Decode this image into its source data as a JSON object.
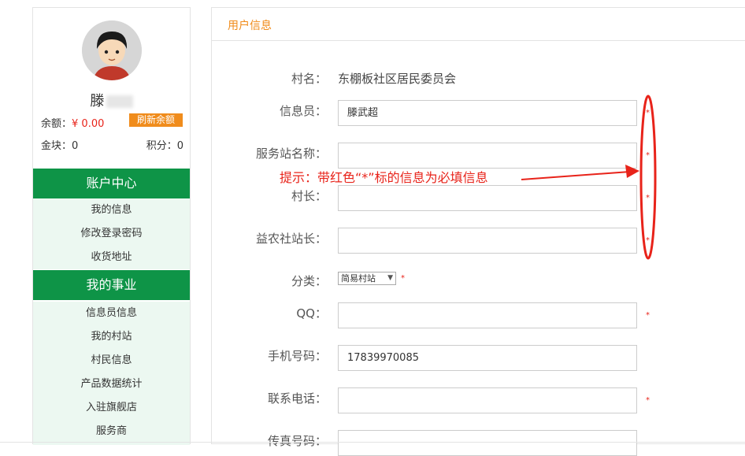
{
  "sidebar": {
    "username_visible": "滕",
    "balance_label": "余额：",
    "balance_value": "¥ 0.00",
    "refresh_button": "刷新余额",
    "gold_label": "金块：0",
    "points_label": "积分：0",
    "sections": [
      {
        "title": "账户中心",
        "items": [
          "我的信息",
          "修改登录密码",
          "收货地址"
        ]
      },
      {
        "title": "我的事业",
        "items": [
          "信息员信息",
          "我的村站",
          "村民信息",
          "产品数据统计",
          "入驻旗舰店",
          "服务商"
        ]
      }
    ]
  },
  "main": {
    "title": "用户信息",
    "village_label": "村名：",
    "village_value": "东棚板社区居民委员会",
    "fields": {
      "informant": {
        "label": "信息员：",
        "value": "滕武超"
      },
      "station_name": {
        "label": "服务站名称：",
        "value": ""
      },
      "village_head": {
        "label": "村长：",
        "value": ""
      },
      "yinong_head": {
        "label": "益农社站长：",
        "value": ""
      },
      "category": {
        "label": "分类：",
        "selected": "简易村站"
      },
      "qq": {
        "label": "QQ：",
        "value": ""
      },
      "mobile": {
        "label": "手机号码：",
        "value": "17839970085"
      },
      "phone": {
        "label": "联系电话：",
        "value": ""
      },
      "fax": {
        "label": "传真号码：",
        "value": ""
      }
    },
    "required_mark": "*"
  },
  "annotation": {
    "hint": "提示：带红色“*”标的信息为必填信息"
  },
  "colors": {
    "green": "#0e9447",
    "orange": "#f08c1c",
    "red": "#e8231a"
  }
}
